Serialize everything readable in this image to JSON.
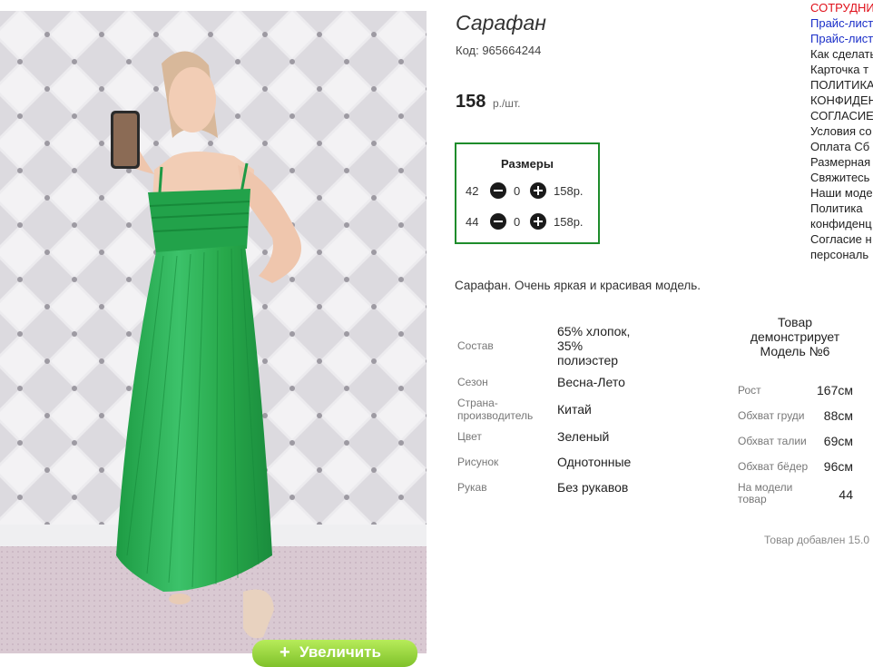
{
  "product": {
    "title": "Сарафан",
    "code": "Код: 965664244",
    "price": "158",
    "price_unit": "р./шт.",
    "description": "Сарафан. Очень яркая и красивая модель.",
    "zoom_label": "Увеличить"
  },
  "sizes": {
    "header": "Размеры",
    "rows": [
      {
        "size": "42",
        "qty": "0",
        "price": "158р."
      },
      {
        "size": "44",
        "qty": "0",
        "price": "158р."
      }
    ]
  },
  "attributes": [
    {
      "label": "Состав",
      "value": "65% хлопок, 35% полиэстер"
    },
    {
      "label": "Сезон",
      "value": "Весна-Лето"
    },
    {
      "label": "Страна-производитель",
      "value": "Китай"
    },
    {
      "label": "Цвет",
      "value": "Зеленый"
    },
    {
      "label": "Рисунок",
      "value": "Однотонные"
    },
    {
      "label": "Рукав",
      "value": "Без рукавов"
    }
  ],
  "model": {
    "title": "Товар демонстрирует Модель №6",
    "params": [
      {
        "label": "Рост",
        "value": "167см"
      },
      {
        "label": "Обхват груди",
        "value": "88см"
      },
      {
        "label": "Обхват талии",
        "value": "69см"
      },
      {
        "label": "Обхват бёдер",
        "value": "96см"
      },
      {
        "label": "На модели товар",
        "value": "44"
      }
    ]
  },
  "added": "Товар добавлен 15.0",
  "menu": [
    "СОТРУДНИ",
    "Прайс-лист",
    "Прайс-лист",
    "Как сделать",
    "Карточка т",
    "ПОЛИТИКА",
    "КОНФИДЕН",
    "СОГЛАСИЕ",
    "Условия со",
    "Оплата Сб",
    "Размерная",
    "Свяжитесь",
    "Наши моде",
    "Политика",
    "конфиденц",
    "Согласие н",
    "персональ"
  ],
  "colors": {
    "frame": "#1e8c2b",
    "dress": "#27a84a",
    "menu_red": "#e0101a",
    "menu_blue": "#1a2ec8"
  }
}
